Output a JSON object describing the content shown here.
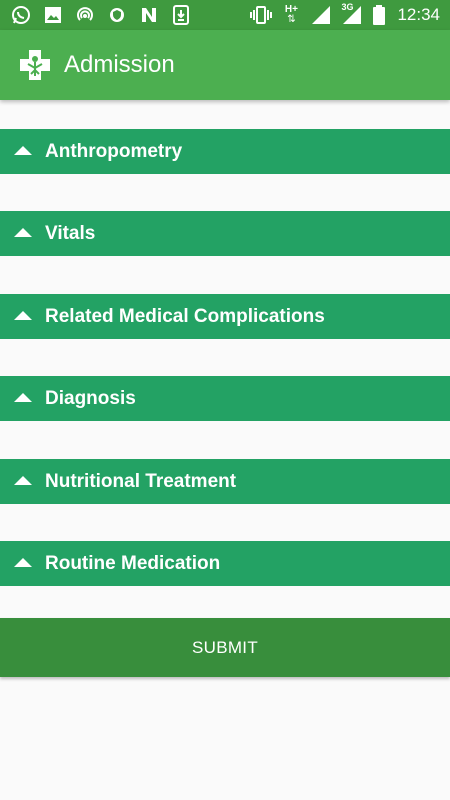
{
  "status_bar": {
    "left_icons": [
      "whatsapp-icon",
      "image-icon",
      "hotspot-icon",
      "vpn-shield-icon",
      "n-app-icon",
      "download-icon"
    ],
    "right_icons": [
      "vibrate-icon",
      "hplus-data-icon",
      "signal-icon",
      "3g-signal-icon",
      "battery-icon"
    ],
    "network_label": "3G",
    "data_label": "H+",
    "time": "12:34"
  },
  "app_bar": {
    "title": "Admission",
    "logo_icon": "medical-cross-icon"
  },
  "sections": [
    {
      "label": "Anthropometry",
      "icon": "collapse-arrow-icon"
    },
    {
      "label": "Vitals",
      "icon": "collapse-arrow-icon"
    },
    {
      "label": "Related Medical Complications",
      "icon": "collapse-arrow-icon"
    },
    {
      "label": "Diagnosis",
      "icon": "collapse-arrow-icon"
    },
    {
      "label": "Nutritional Treatment",
      "icon": "collapse-arrow-icon"
    },
    {
      "label": "Routine Medication",
      "icon": "collapse-arrow-icon"
    }
  ],
  "submit_label": "SUBMIT",
  "colors": {
    "status_bar": "#3f9a3f",
    "app_bar": "#4caf50",
    "section_header": "#23a264",
    "submit_button": "#388e3c",
    "background": "#fafafa"
  }
}
